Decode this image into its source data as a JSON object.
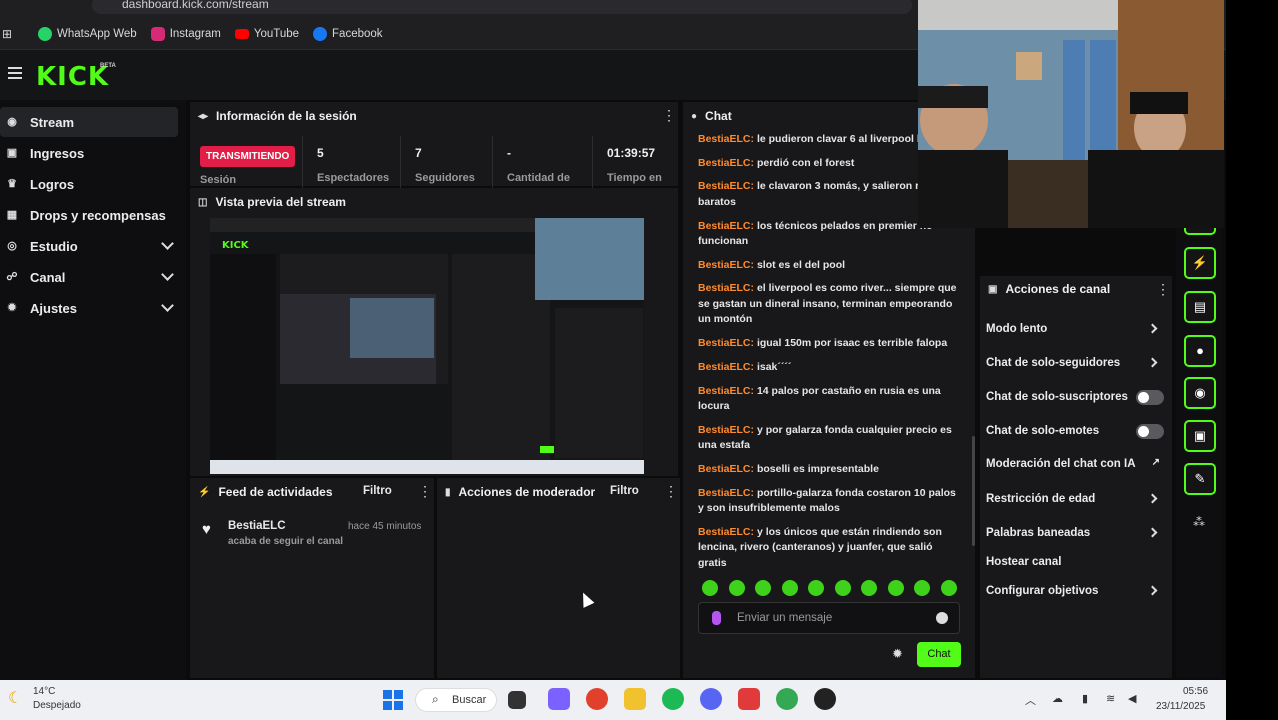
{
  "browser": {
    "url": "dashboard.kick.com/stream",
    "bookmarks": [
      "WhatsApp Web",
      "Instagram",
      "YouTube",
      "Facebook"
    ]
  },
  "brand": {
    "logo": "KICK",
    "beta": "BETA",
    "accent": "#53fc18"
  },
  "sidebar": {
    "items": [
      {
        "label": "Stream",
        "icon": "broadcast-icon"
      },
      {
        "label": "Ingresos",
        "icon": "wallet-icon"
      },
      {
        "label": "Logros",
        "icon": "trophy-icon"
      },
      {
        "label": "Drops y recompensas",
        "icon": "gift-icon"
      },
      {
        "label": "Estudio",
        "icon": "studio-icon"
      },
      {
        "label": "Canal",
        "icon": "channel-icon"
      },
      {
        "label": "Ajustes",
        "icon": "gear-icon"
      }
    ]
  },
  "session": {
    "title": "Información de la sesión",
    "live_badge": "TRANSMITIENDO",
    "session_label": "Sesión",
    "stats": [
      {
        "value": "5",
        "label": "Espectadores"
      },
      {
        "value": "7",
        "label": "Seguidores"
      },
      {
        "value": "-",
        "label": "Cantidad de"
      },
      {
        "value": "01:39:57",
        "label": "Tiempo en"
      }
    ]
  },
  "preview": {
    "title": "Vista previa del stream"
  },
  "activity": {
    "title": "Feed de actividades",
    "filter": "Filtro",
    "items": [
      {
        "user": "BestiaELC",
        "text": "acaba de seguir el canal",
        "time": "hace 45 minutos"
      }
    ]
  },
  "moderator": {
    "title": "Acciones de moderador",
    "filter": "Filtro"
  },
  "chat": {
    "title": "Chat",
    "messages": [
      {
        "user": "BestiaELC",
        "text": "le pudieron clavar 6 al liverpool hoy"
      },
      {
        "user": "BestiaELC",
        "text": "perdió con el forest"
      },
      {
        "user": "BestiaELC",
        "text": "le clavaron 3 nomás, y salieron reo baratos"
      },
      {
        "user": "BestiaELC",
        "text": "los técnicos pelados en premier no funcionan"
      },
      {
        "user": "BestiaELC",
        "text": "slot es el del pool"
      },
      {
        "user": "BestiaELC",
        "text": "el liverpool es como river... siempre que se gastan un dineral insano, terminan empeorando un montón"
      },
      {
        "user": "BestiaELC",
        "text": "igual 150m por isaac es terrible falopa"
      },
      {
        "user": "BestiaELC",
        "text": "isak´´´´"
      },
      {
        "user": "BestiaELC",
        "text": "14 palos por castaño en rusia es una locura"
      },
      {
        "user": "BestiaELC",
        "text": "y por galarza fonda cualquier precio es una estafa"
      },
      {
        "user": "BestiaELC",
        "text": "boselli es impresentable"
      },
      {
        "user": "BestiaELC",
        "text": "portillo-galarza fonda costaron 10 palos y son insufriblemente malos"
      },
      {
        "user": "BestiaELC",
        "text": "y los únicos que están rindiendo son lencina, rivero (canteranos) y juanfer, que salió gratis"
      }
    ],
    "input_placeholder": "Enviar un mensaje",
    "send_label": "Chat"
  },
  "channel_actions": {
    "title": "Acciones de canal",
    "items": [
      {
        "label": "Modo lento",
        "control": "chevron"
      },
      {
        "label": "Chat de solo-seguidores",
        "control": "chevron"
      },
      {
        "label": "Chat de solo-suscriptores",
        "control": "toggle"
      },
      {
        "label": "Chat de solo-emotes",
        "control": "toggle"
      },
      {
        "label": "Moderación del chat con IA",
        "control": "external"
      },
      {
        "label": "Restricción de edad",
        "control": "chevron"
      },
      {
        "label": "Palabras baneadas",
        "control": "chevron"
      },
      {
        "label": "Hostear canal",
        "control": "none"
      },
      {
        "label": "Configurar objetivos",
        "control": "chevron"
      }
    ]
  },
  "taskbar": {
    "weather_temp": "14°C",
    "weather_desc": "Despejado",
    "search": "Buscar",
    "time": "05:56",
    "date": "23/11/2025"
  }
}
